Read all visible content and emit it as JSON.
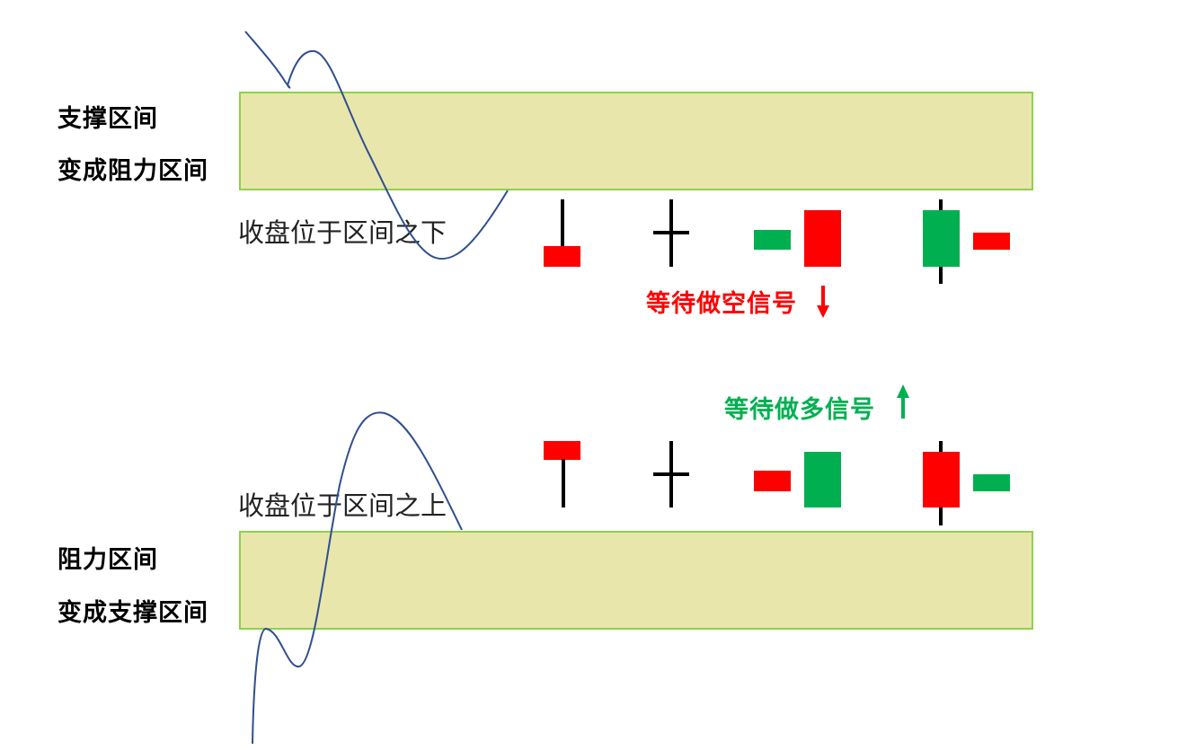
{
  "top": {
    "label_line1": "支撑区间",
    "label_line2": "变成阻力区间",
    "note": "收盘位于区间之下",
    "signal": "等待做空信号"
  },
  "bottom": {
    "label_line1": "阻力区间",
    "label_line2": "变成支撑区间",
    "note": "收盘位于区间之上",
    "signal": "等待做多信号"
  },
  "colors": {
    "zone_fill": "#e9e6ac",
    "zone_border": "#8fd04f",
    "bear_red": "#ff0000",
    "bull_green": "#00b050",
    "price_line": "#2f4f8f",
    "wick": "#000000"
  },
  "icons": {
    "short_arrow": "arrow-down-icon",
    "long_arrow": "arrow-up-icon"
  }
}
